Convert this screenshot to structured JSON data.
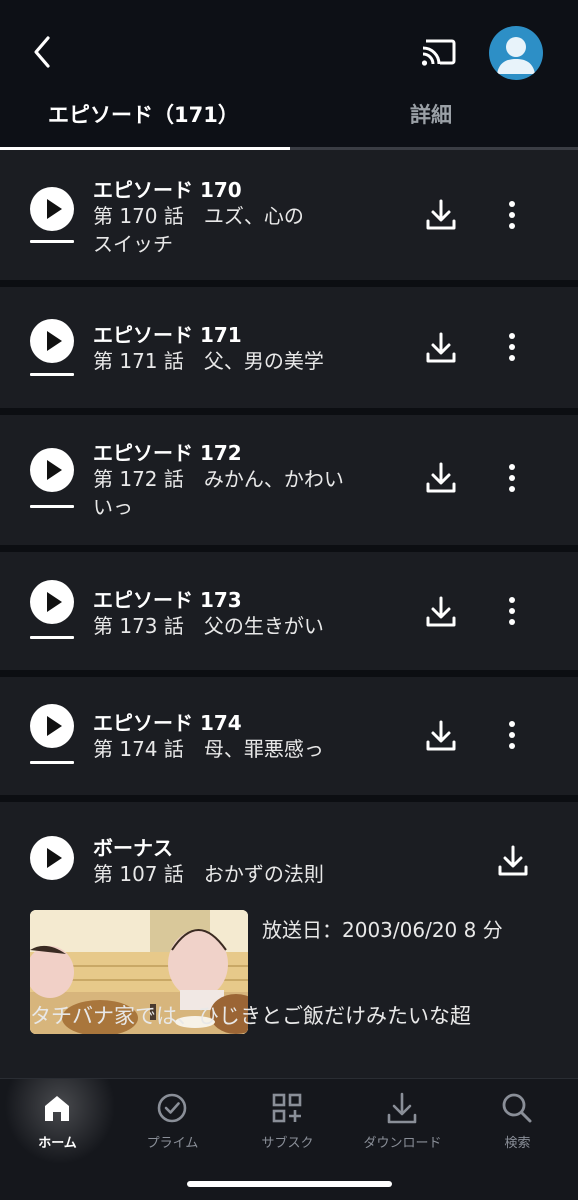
{
  "tabs": {
    "episodes": "エピソード（171）",
    "details": "詳細"
  },
  "episodes": [
    {
      "title": "エピソード 170",
      "subtitle": "第 170 話　ユズ、心のスイッチ",
      "subtitle_line1": "第 170 話　ユズ、心の",
      "subtitle_line2": "スイッチ"
    },
    {
      "title": "エピソード 171",
      "subtitle": "第 171 話　父、男の美学"
    },
    {
      "title": "エピソード 172",
      "subtitle": "第 172 話　みかん、かわいいっ",
      "subtitle_line1": "第 172 話　みかん、かわい",
      "subtitle_line2": "いっ"
    },
    {
      "title": "エピソード 173",
      "subtitle": "第 173 話　父の生きがい"
    },
    {
      "title": "エピソード 174",
      "subtitle": "第 174 話　母、罪悪感っ"
    }
  ],
  "bonus": {
    "title": "ボーナス",
    "subtitle": "第 107 話　おかずの法則",
    "meta": "放送日：2003/06/20 8 分",
    "synopsis": "タチバナ家では、ひじきとご飯だけみたいな超"
  },
  "nav": [
    {
      "label": "ホーム",
      "icon": "home-icon"
    },
    {
      "label": "プライム",
      "icon": "check-circle-icon"
    },
    {
      "label": "サブスク",
      "icon": "grid-plus-icon"
    },
    {
      "label": "ダウンロード",
      "icon": "download-icon"
    },
    {
      "label": "検索",
      "icon": "search-icon"
    }
  ],
  "colors": {
    "background": "#0f1117",
    "row": "#1b1d22",
    "avatar": "#2d8fc6"
  }
}
